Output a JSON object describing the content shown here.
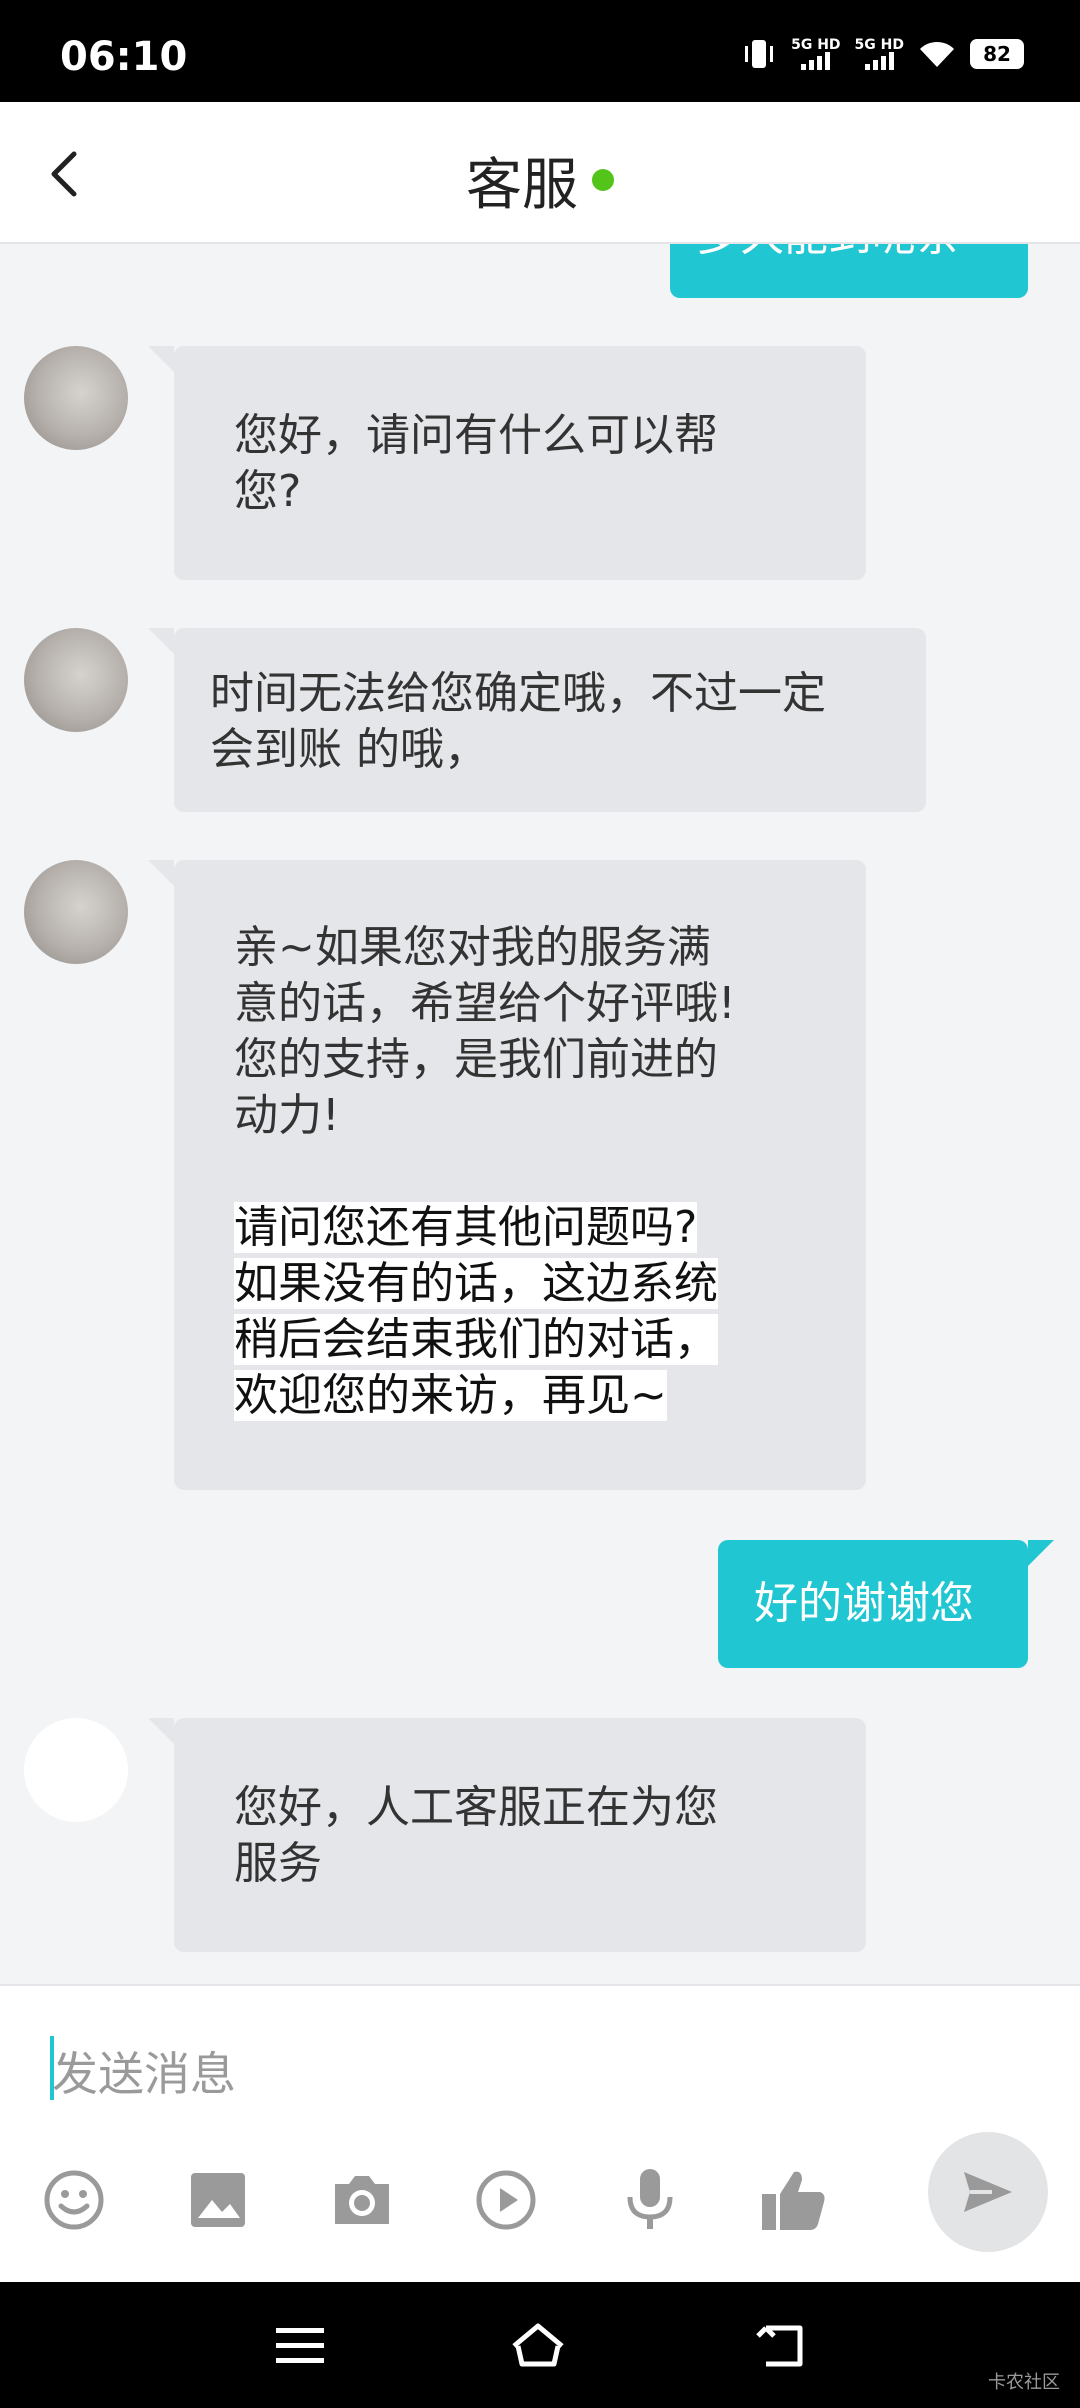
{
  "status": {
    "time": "06:10",
    "net1": "5G HD",
    "net2": "5G HD",
    "battery": "82"
  },
  "header": {
    "title": "客服"
  },
  "messages": [
    {
      "side": "right",
      "text": "多久能到呢亲"
    },
    {
      "side": "left",
      "text": "您好，请问有什么可以帮\n您?"
    },
    {
      "side": "left",
      "text": "时间无法给您确定哦，不过一定\n会到账 的哦，"
    },
    {
      "side": "left",
      "text": "亲~如果您对我的服务满\n意的话，希望给个好评哦!\n您的支持，是我们前进的\n动力!",
      "highlight": "请问您还有其他问题吗?\n如果没有的话，这边系统\n稍后会结束我们的对话，\n欢迎您的来访，再见~"
    },
    {
      "side": "right",
      "text": "好的谢谢您"
    },
    {
      "side": "left",
      "text": "您好，人工客服正在为您\n服务"
    }
  ],
  "input": {
    "placeholder": "发送消息"
  },
  "toolbar": [
    "emoji-icon",
    "image-icon",
    "camera-icon",
    "video-icon",
    "mic-icon",
    "thumbs-up-icon"
  ],
  "watermark": "卡农社区",
  "colors": {
    "accent": "#20c6d2",
    "online": "#52c41a",
    "bubble_left": "#e5e6ea"
  }
}
